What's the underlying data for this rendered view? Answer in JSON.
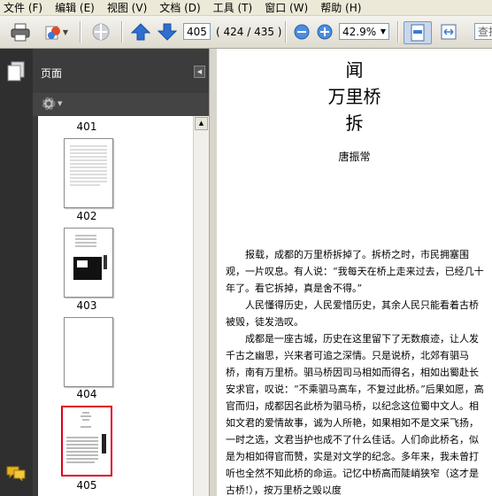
{
  "menu": [
    "文件 (F)",
    "编辑 (E)",
    "视图 (V)",
    "文档 (D)",
    "工具 (T)",
    "窗口 (W)",
    "帮助 (H)"
  ],
  "toolbar": {
    "page_input": "405",
    "page_count": "( 424 / 435 )",
    "zoom_value": "42.9%",
    "search_placeholder": "查找"
  },
  "panel": {
    "title": "页面"
  },
  "thumbnails": [
    {
      "label": "401"
    },
    {
      "label": "402"
    },
    {
      "label": "403"
    },
    {
      "label": "404"
    },
    {
      "label": "405",
      "selected": true
    }
  ],
  "document": {
    "title_line1": "闻",
    "title_line2": "万里桥",
    "title_line3": "拆",
    "author": "唐振常",
    "paragraphs": [
      "报载，成都的万里桥拆掉了。拆桥之时，市民拥塞围观，一片叹息。有人说：“我每天在桥上走来过去，已经几十年了。看它拆掉，真是舍不得。”",
      "人民懂得历史，人民爱惜历史，其余人民只能看着古桥被毁，徒发浩叹。",
      "成都是一座古城，历史在这里留下了无数痕迹，让人发千古之幽思，兴来者可追之深情。只是说桥，北郊有驷马桥，南有万里桥。驷马桥因司马相如而得名，相如出蜀赴长安求官，叹说：“不乘驷马高车，不复过此桥。”后果如愿，高官而归，成都因名此桥为驷马桥，以纪念这位蜀中文人。相如文君的爱情故事，诚为人所艳，如果相如不是文采飞扬，一时之选，文君当护也成不了什么佳话。人们命此桥名，似是为相如得官而赞，实是对文学的纪念。多年来，我未曾打听也全然不知此桥的命运。记忆中桥高而陡峭狭窄（这才是古桥!），按万里桥之毁以度"
    ]
  },
  "colors": {
    "accent_selected": "#e0001b",
    "panel_dark": "#3a3a3a"
  }
}
